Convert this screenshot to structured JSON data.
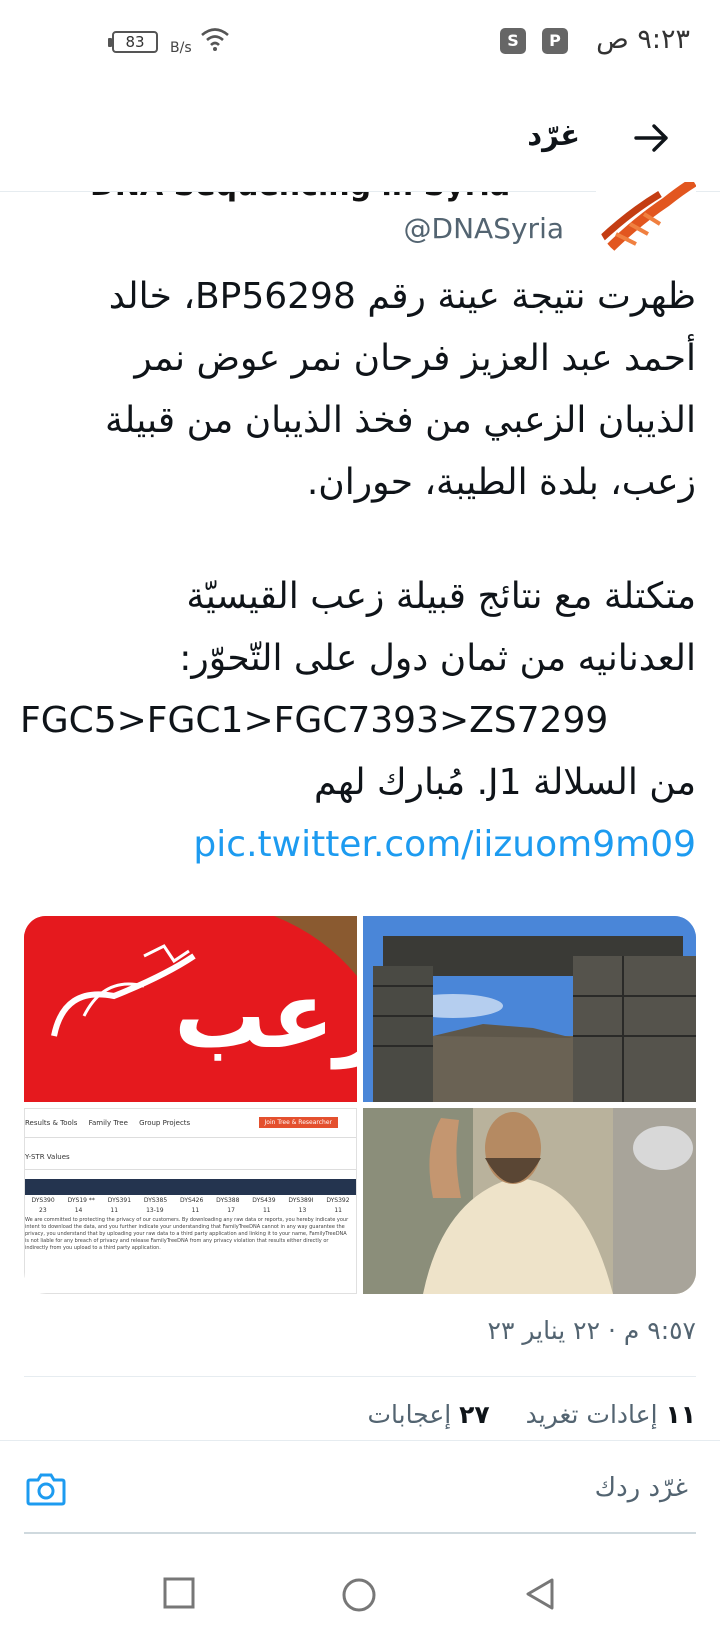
{
  "status_bar": {
    "time": "٩:٢٣ ص",
    "battery": "83",
    "net_speed": "B/s"
  },
  "header": {
    "title": "غرّد"
  },
  "tweet": {
    "author_name": "DNA Sequencing in Syria",
    "handle": "@DNASyria",
    "text_lines": [
      "ظهرت نتيجة عينة رقم BP56298، خالد",
      "أحمد عبد العزيز فرحان نمر عوض نمر",
      "الذيبان الزعبي من فخذ الذيبان من قبيلة",
      "زعب، بلدة الطيبة، حوران."
    ],
    "text_lines_2": [
      "متكتلة مع نتائج قبيلة زعب القيسيّة",
      "العدنانيه من ثمان دول على التّحوّر:"
    ],
    "snp_path": "FGC5>FGC1>FGC7393>ZS7299",
    "lineage_line": "من السلالة J1. مُبارك لهم",
    "link": "pic.twitter.com/iizuom9m09",
    "timestamp": "٩:٥٧ م · ٢٢ يناير ٢٣",
    "stats": {
      "retweets_count": "١١",
      "retweets_label": "إعادات تغريد",
      "likes_count": "٢٧",
      "likes_label": "إعجابات"
    }
  },
  "media": {
    "red_banner_text": "زعب",
    "doc_nav": [
      "Results & Tools",
      "Family Tree",
      "Group Projects"
    ],
    "doc_button": "Join Tree & Researcher",
    "doc_subtitle": "Y-STR Values",
    "doc_markers": [
      "DYS390",
      "DYS19 **",
      "DYS391",
      "DYS385",
      "DYS426",
      "DYS388",
      "DYS439",
      "DYS389I",
      "DYS392"
    ],
    "doc_values": [
      "23",
      "14",
      "11",
      "13-19",
      "11",
      "17",
      "11",
      "13",
      "11"
    ],
    "doc_paragraph": "We are committed to protecting the privacy of our customers. By downloading any raw data or reports, you hereby indicate your intent to download the data, and you further indicate your understanding that FamilyTreeDNA cannot in any way guarantee the privacy, you understand that by uploading your raw data to a third party application and linking it to your name, FamilyTreeDNA is not liable for any breach of privacy and release FamilyTreeDNA from any privacy violation that results either directly or indirectly from you upload to a third party application."
  },
  "reply": {
    "placeholder": "غرّد ردك"
  },
  "colors": {
    "link": "#1d9bf0",
    "secondary_text": "#536471",
    "banner_red": "#e5191e"
  },
  "icons": [
    "back-arrow-icon",
    "camera-icon",
    "wifi-icon",
    "battery-icon",
    "nav-square-icon",
    "nav-circle-icon",
    "nav-back-triangle-icon"
  ]
}
